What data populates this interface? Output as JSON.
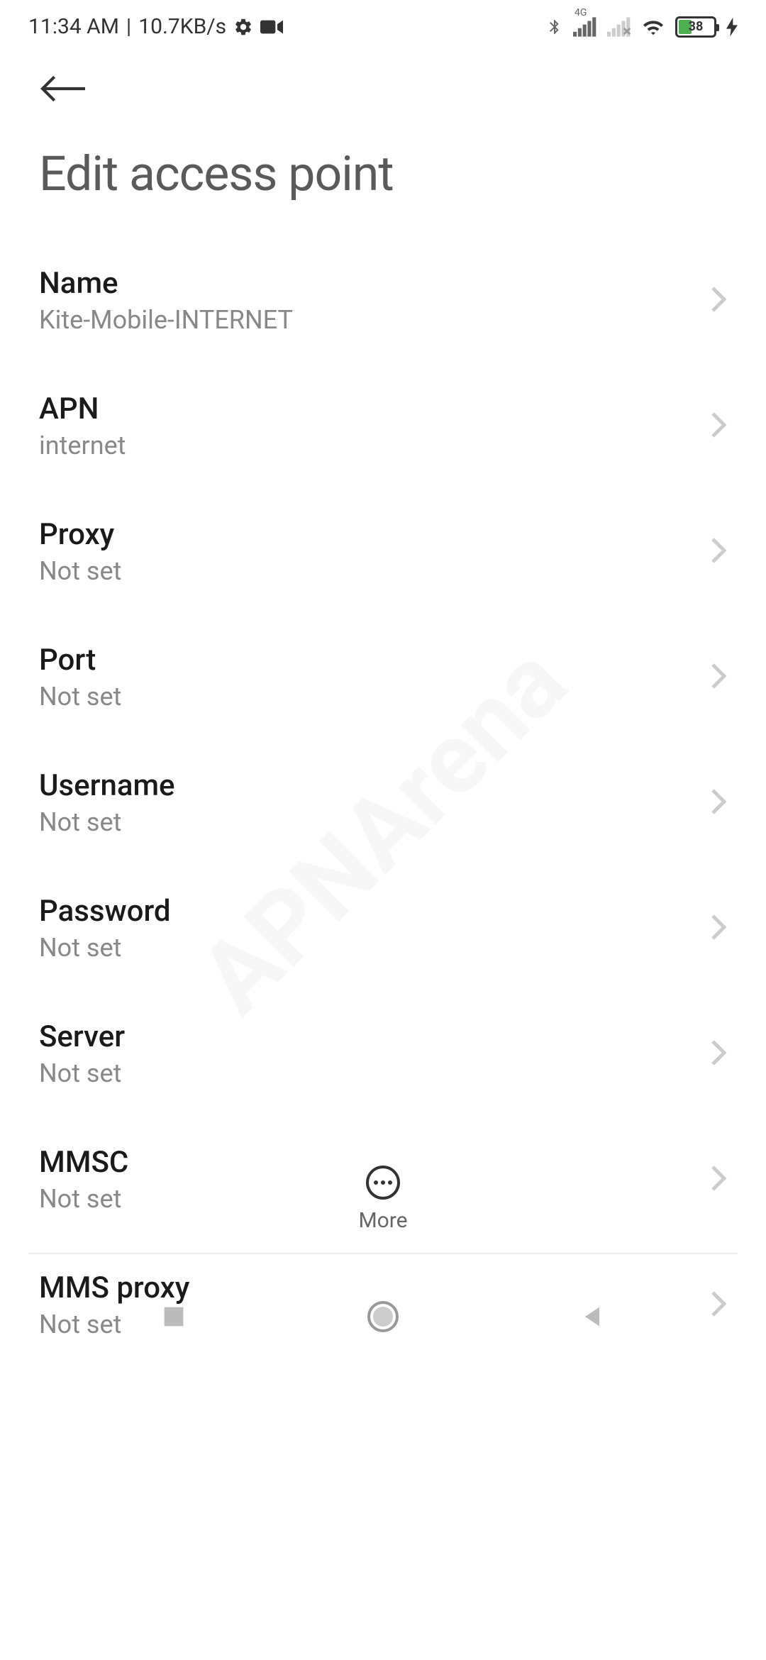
{
  "status_bar": {
    "time": "11:34 AM",
    "data_rate": "10.7KB/s",
    "network_label": "4G",
    "battery_percent": "38"
  },
  "header": {
    "title": "Edit access point"
  },
  "settings": [
    {
      "label": "Name",
      "value": "Kite-Mobile-INTERNET"
    },
    {
      "label": "APN",
      "value": "internet"
    },
    {
      "label": "Proxy",
      "value": "Not set"
    },
    {
      "label": "Port",
      "value": "Not set"
    },
    {
      "label": "Username",
      "value": "Not set"
    },
    {
      "label": "Password",
      "value": "Not set"
    },
    {
      "label": "Server",
      "value": "Not set"
    },
    {
      "label": "MMSC",
      "value": "Not set"
    },
    {
      "label": "MMS proxy",
      "value": "Not set"
    }
  ],
  "bottom_action": {
    "more_label": "More"
  },
  "watermark": "APNArena"
}
